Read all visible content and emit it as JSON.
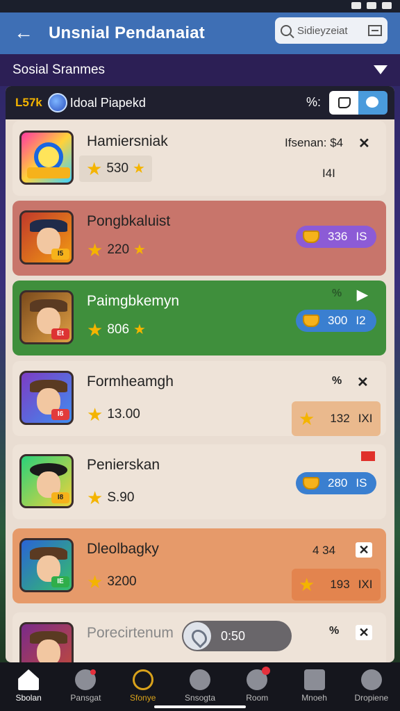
{
  "status_bar": {},
  "app_bar": {
    "back_icon": "arrow-left-icon",
    "title": "Unsnial Pendanaiat",
    "search": {
      "placeholder": "Sidieyzeiat"
    }
  },
  "section": {
    "label": "Sosial Sranmes"
  },
  "panel_header": {
    "code": "L57k",
    "name": "Idoal Piapekd",
    "percent_label": "%:",
    "colors": {
      "code": "#f4b400",
      "toggle_active": "#4a9bdc"
    }
  },
  "rows": [
    {
      "name": "Hamiersniak",
      "stars": "530",
      "right_text": "Ifsenan: $4",
      "sub_text": "I4I",
      "bg": "#e9ddd2",
      "tag": ""
    },
    {
      "name": "Pongbkaluist",
      "stars": "220",
      "pill": {
        "value": "336",
        "suffix": "IS"
      },
      "bg": "#c8756b",
      "tag": "I5"
    },
    {
      "name": "Paimgbkemyn",
      "stars": "806",
      "pill": {
        "value": "300",
        "suffix": "I2"
      },
      "bg": "#3f8f3c",
      "tag": "Et"
    },
    {
      "name": "Formheamgh",
      "stars": "13.00",
      "pill": {
        "value": "132",
        "suffix": "IXI"
      },
      "bg": "#e9ddd2",
      "tag": "I6"
    },
    {
      "name": "Penierskan",
      "stars": "S.90",
      "pill": {
        "value": "280",
        "suffix": "IS"
      },
      "bg": "#e9ddd2",
      "tag": "I8"
    },
    {
      "name": "Dleolbagky",
      "stars": "3200",
      "pill": {
        "value": "193",
        "suffix": "IXI"
      },
      "right_text": "4 34",
      "bg": "#e69a6a",
      "tag": "IE"
    },
    {
      "name": "Porecirtenum",
      "bg": "#e9ddd2"
    }
  ],
  "toast": {
    "text": "0:50"
  },
  "bottom_nav": [
    {
      "label": "Sbolan",
      "icon": "home-icon"
    },
    {
      "label": "Pansgat",
      "icon": "shield-icon"
    },
    {
      "label": "Sfonye",
      "icon": "compass-icon"
    },
    {
      "label": "Snsogta",
      "icon": "bird-icon"
    },
    {
      "label": "Room",
      "icon": "chat-icon"
    },
    {
      "label": "Mnoeh",
      "icon": "gift-icon"
    },
    {
      "label": "Dropiene",
      "icon": "profile-icon"
    }
  ]
}
